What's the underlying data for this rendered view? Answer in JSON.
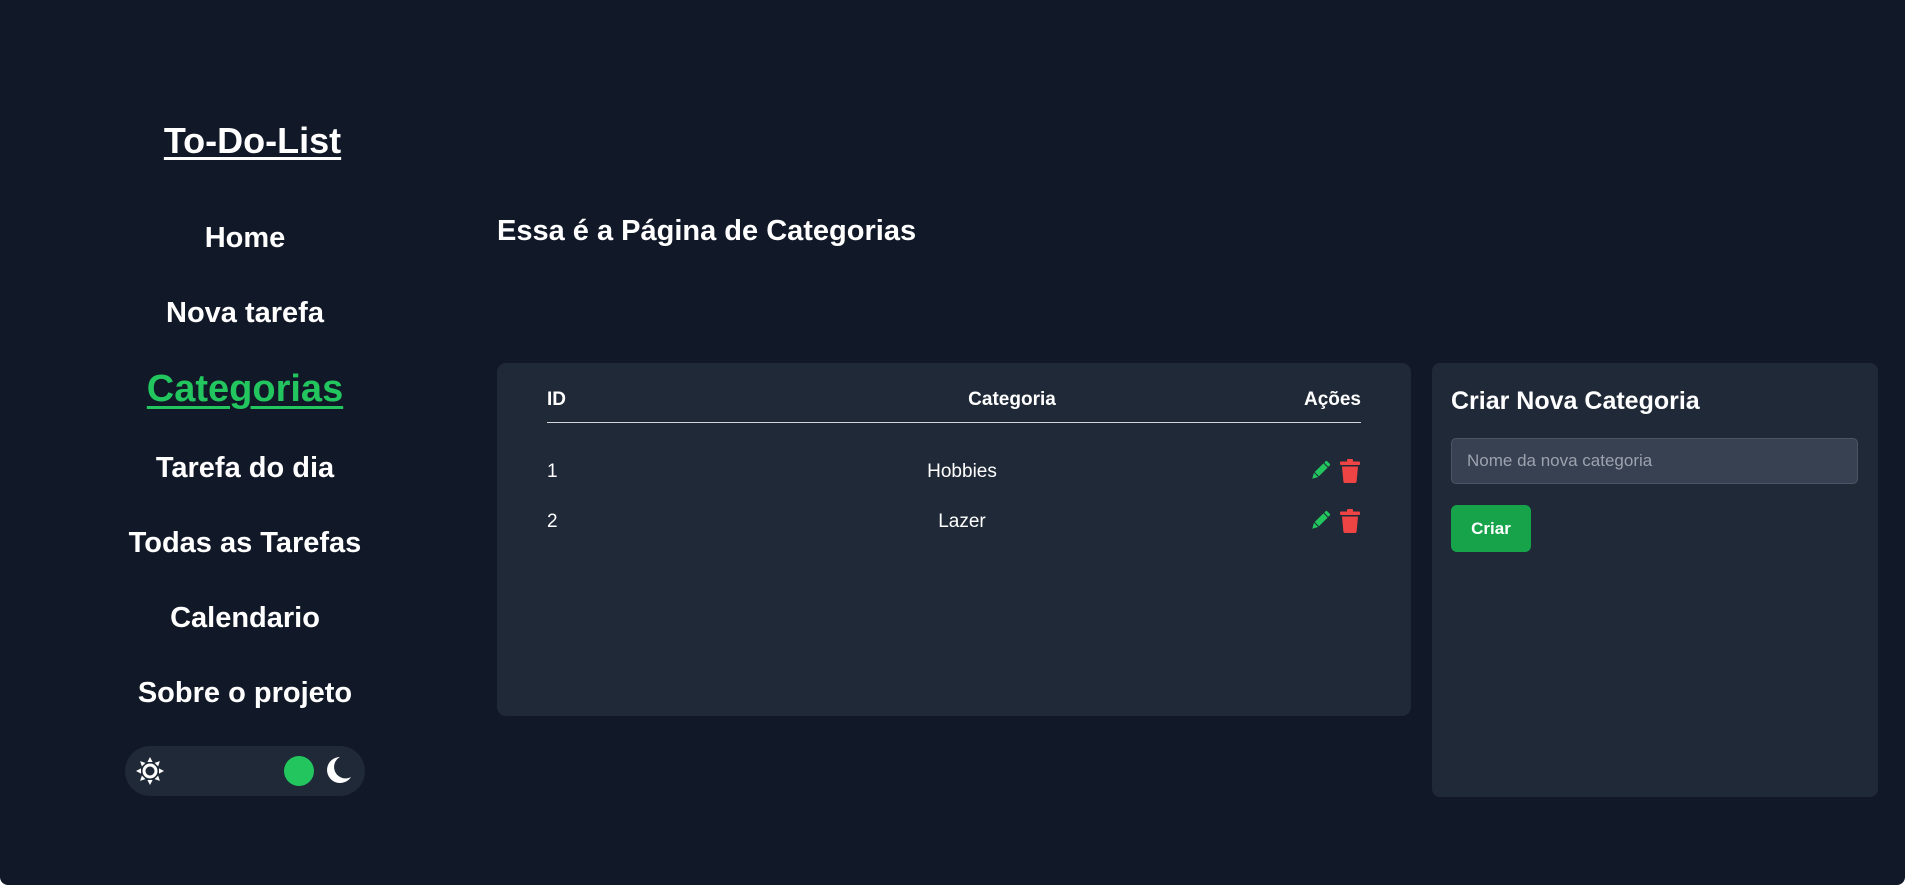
{
  "app": {
    "title": "To-Do-List"
  },
  "sidebar": {
    "items": [
      {
        "label": "Home",
        "active": false
      },
      {
        "label": "Nova tarefa",
        "active": false
      },
      {
        "label": "Categorias",
        "active": true
      },
      {
        "label": "Tarefa do dia",
        "active": false
      },
      {
        "label": "Todas as Tarefas",
        "active": false
      },
      {
        "label": "Calendario",
        "active": false
      },
      {
        "label": "Sobre o projeto",
        "active": false
      }
    ],
    "theme_toggle": {
      "left_icon": "sun-icon",
      "right_icon": "moon-icon",
      "mode": "dark"
    }
  },
  "main": {
    "title": "Essa é a Página de Categorias",
    "table": {
      "headers": {
        "id": "ID",
        "category": "Categoria",
        "actions": "Ações"
      },
      "rows": [
        {
          "id": "1",
          "category": "Hobbies",
          "edit_icon": "pencil-icon",
          "delete_icon": "trash-icon"
        },
        {
          "id": "2",
          "category": "Lazer",
          "edit_icon": "pencil-icon",
          "delete_icon": "trash-icon"
        }
      ]
    },
    "form": {
      "title": "Criar Nova Categoria",
      "input_placeholder": "Nome da nova categoria",
      "input_value": "",
      "button_label": "Criar"
    }
  },
  "colors": {
    "background": "#111827",
    "card": "#1f2937",
    "accent": "#22c55e",
    "button": "#16a34a",
    "delete": "#ef4444",
    "text": "#ffffff"
  }
}
